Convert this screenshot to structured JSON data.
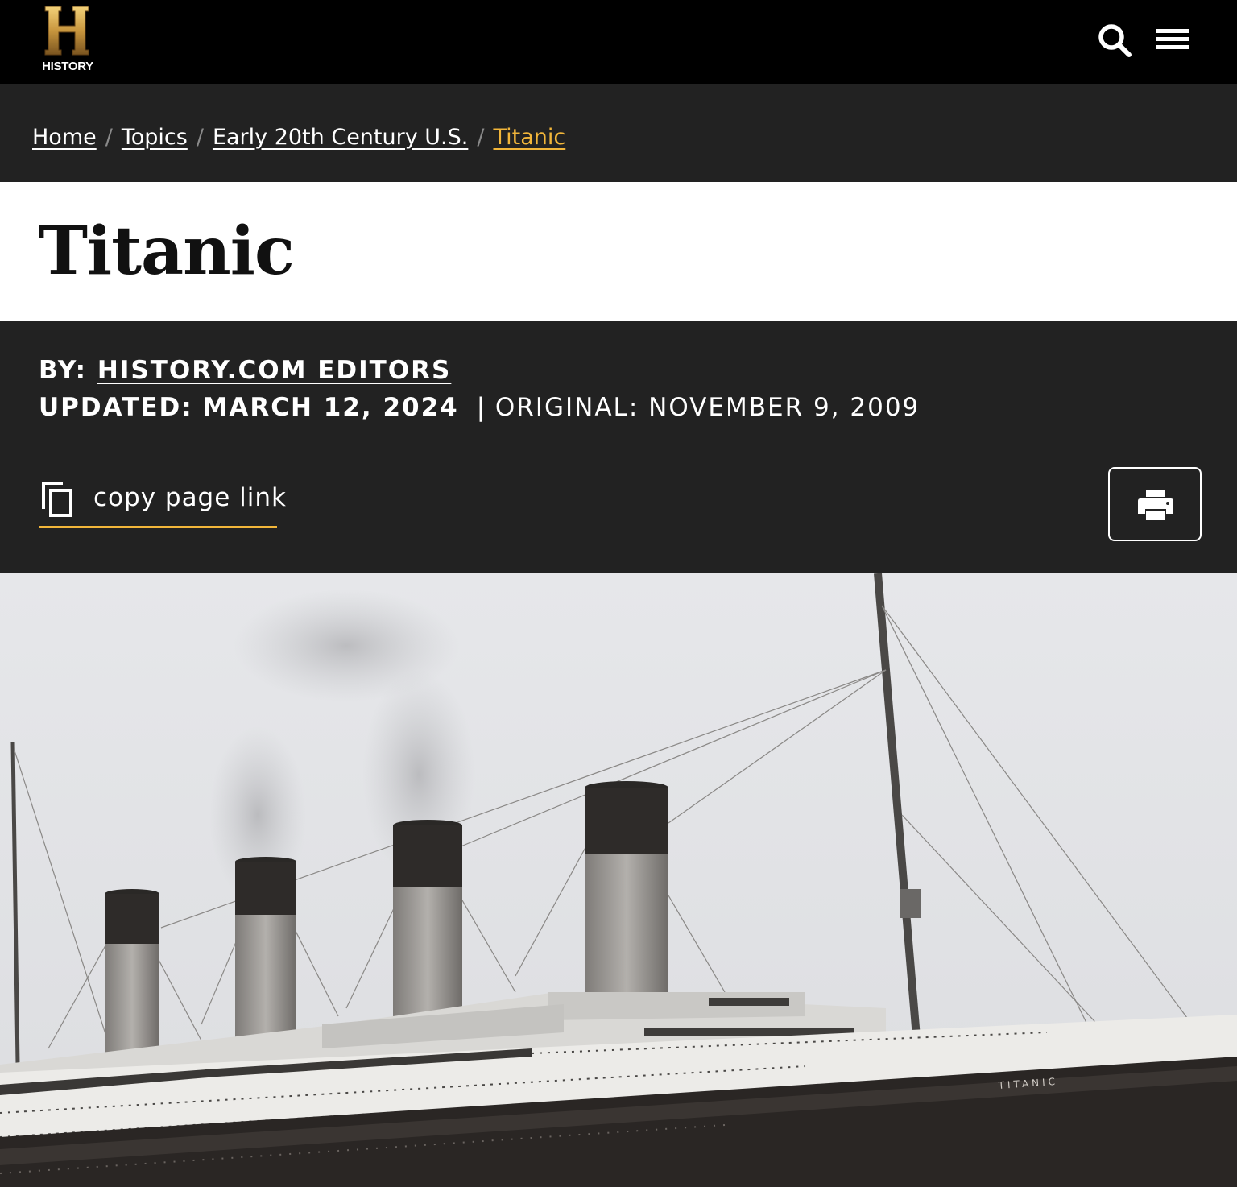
{
  "brand": {
    "logo_letter": "H",
    "logo_word": "HISTORY",
    "logo_gold": "#c8963e"
  },
  "header": {
    "search_icon": "search-icon",
    "menu_icon": "hamburger-menu-icon"
  },
  "breadcrumb": {
    "items": [
      "Home",
      "Topics",
      "Early 20th Century U.S.",
      "Titanic"
    ],
    "separator": "/",
    "current_color": "#f2b63a"
  },
  "article": {
    "title": "Titanic",
    "by_label": "BY:",
    "author": "HISTORY.COM EDITORS",
    "updated_label": "UPDATED:",
    "updated_date": "MARCH 12, 2024",
    "divider": "|",
    "original_label": "ORIGINAL:",
    "original_date": "NOVEMBER 9, 2009",
    "copy_link_label": "copy page link",
    "copy_icon": "copy-icon",
    "print_icon": "printer-icon"
  },
  "hero": {
    "description": "photo",
    "hull_name": "TITANIC"
  },
  "colors": {
    "nav_bg": "#000000",
    "panel_bg": "#222222",
    "accent": "#f2b63a",
    "title_bg": "#ffffff"
  }
}
